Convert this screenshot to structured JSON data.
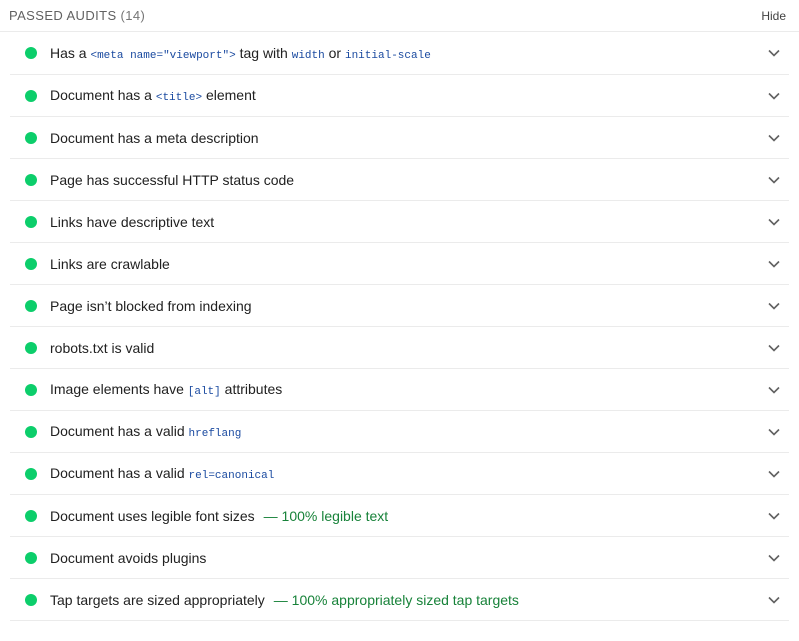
{
  "group": {
    "title": "Passed audits",
    "count": "(14)",
    "toggle_label": "Hide"
  },
  "colors": {
    "pass": "#0cce6b",
    "display_value": "#178239",
    "code": "#1a4aa0"
  },
  "icons": {
    "status": "pass-dot-icon",
    "expand": "chevron-down-icon"
  },
  "audits": [
    {
      "t1": "Has a ",
      "c1": "<meta name=\"viewport\">",
      "t2": " tag with ",
      "c2": "width",
      "t3": " or ",
      "c3": "initial-scale"
    },
    {
      "t1": "Document has a ",
      "c1": "<title>",
      "t2": " element"
    },
    {
      "t1": "Document has a meta description"
    },
    {
      "t1": "Page has successful HTTP status code"
    },
    {
      "t1": "Links have descriptive text"
    },
    {
      "t1": "Links are crawlable"
    },
    {
      "t1": "Page isn’t blocked from indexing"
    },
    {
      "t1": "robots.txt is valid"
    },
    {
      "t1": "Image elements have ",
      "c1": "[alt]",
      "t2": " attributes"
    },
    {
      "t1": "Document has a valid ",
      "c1": "hreflang"
    },
    {
      "t1": "Document has a valid ",
      "c1": "rel=canonical"
    },
    {
      "t1": "Document uses legible font sizes",
      "display": "— 100% legible text"
    },
    {
      "t1": "Document avoids plugins"
    },
    {
      "t1": "Tap targets are sized appropriately",
      "display": "— 100% appropriately sized tap targets"
    }
  ]
}
